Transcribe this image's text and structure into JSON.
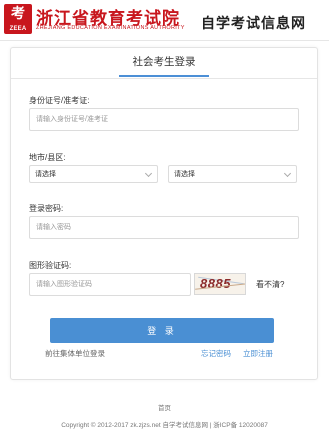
{
  "header": {
    "logo_glyph": "考",
    "logo_abbr": "ZEEA",
    "org_name": "浙江省教育考试院",
    "org_name_en": "ZHEJIANG EDUCATION EXAMINATIONS AUTHORITY",
    "site_name": "自学考试信息网",
    "brand_color": "#c8161d"
  },
  "login": {
    "tab_title": "社会考生登录",
    "id_label": "身份证号/准考证:",
    "id_placeholder": "请输入身份证号/准考证",
    "region_label": "地市/县区:",
    "city_select": "请选择",
    "county_select": "请选择",
    "password_label": "登录密码:",
    "password_placeholder": "请输入密码",
    "captcha_label": "图形验证码:",
    "captcha_placeholder": "请输入图形验证码",
    "captcha_code": "8885",
    "refresh_text": "看不清?",
    "login_button": "登 录",
    "group_login_link": "前往集体单位登录",
    "forgot_link": "忘记密码",
    "register_link": "立即注册",
    "accent_color": "#4a8fd3"
  },
  "footer": {
    "home_link": "首页",
    "copyright": "Copyright © 2012-2017 zk.zjzs.net 自学考试信息网 | 浙ICP备 12020087"
  }
}
